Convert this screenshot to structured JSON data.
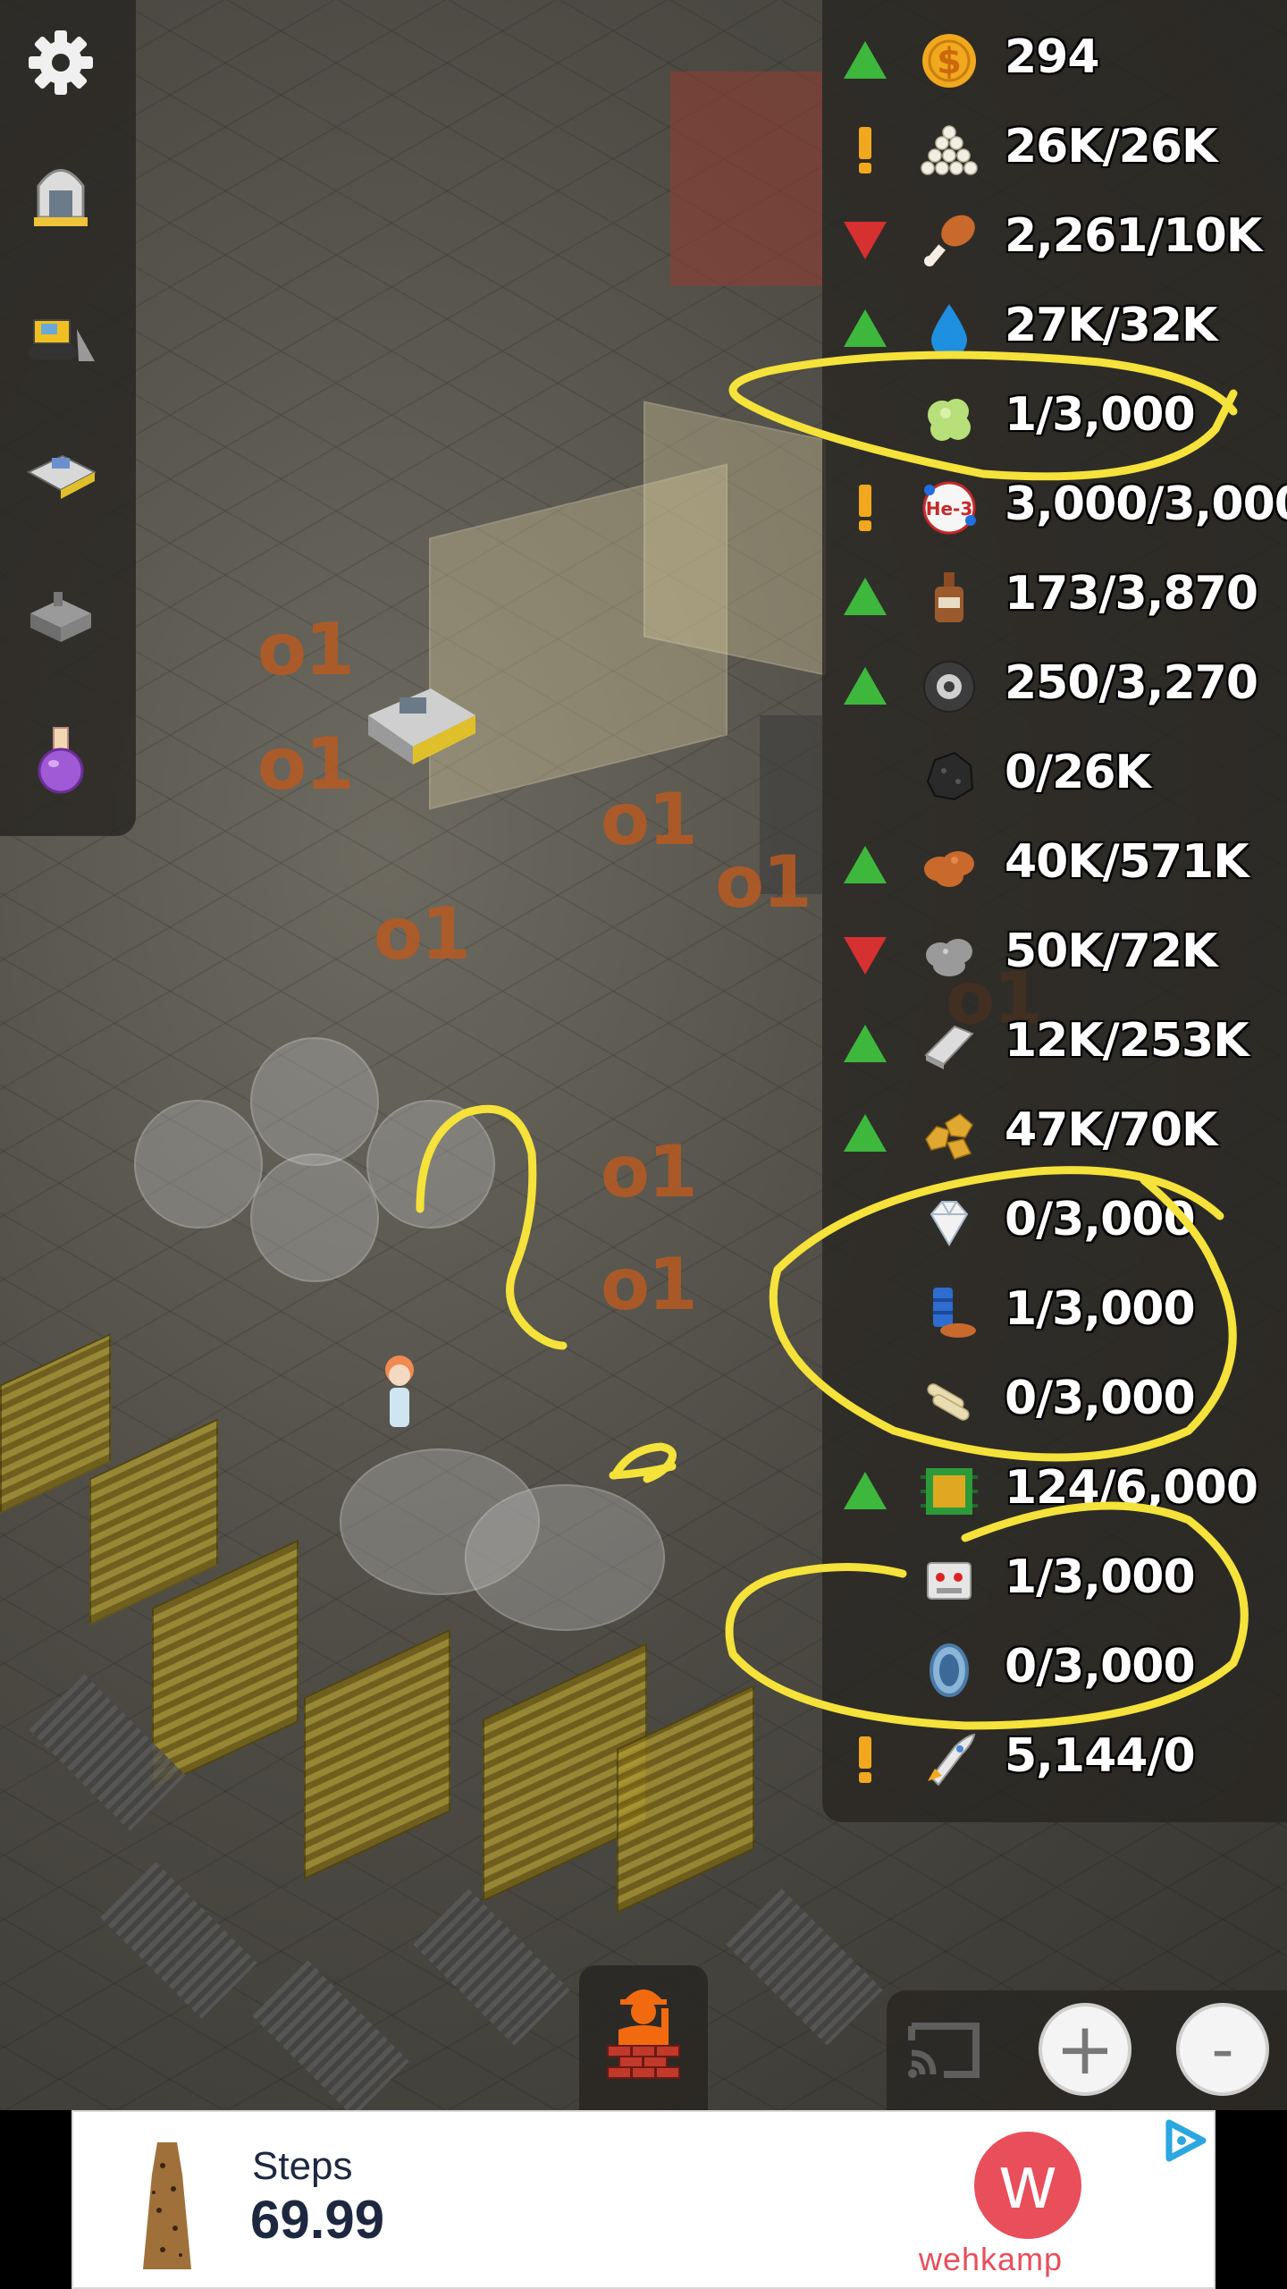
{
  "left_menu": {
    "items": [
      {
        "icon": "gear-icon"
      },
      {
        "icon": "astronaut-habitat-icon"
      },
      {
        "icon": "bulldozer-icon"
      },
      {
        "icon": "rover-icon"
      },
      {
        "icon": "factory-icon"
      },
      {
        "icon": "potion-flask-icon"
      }
    ]
  },
  "resources": [
    {
      "trend": "up",
      "icon": "coin-icon",
      "value": "294"
    },
    {
      "trend": "warning",
      "icon": "crystals-pile-icon",
      "value": "26K/26K"
    },
    {
      "trend": "down",
      "icon": "drumstick-icon",
      "value": "2,261/10K"
    },
    {
      "trend": "up",
      "icon": "water-drop-icon",
      "value": "27K/32K"
    },
    {
      "trend": "none",
      "icon": "green-gas-icon",
      "value": "1/3,000"
    },
    {
      "trend": "warning",
      "icon": "helium-3-icon",
      "icon_text": "He-3",
      "value": "3,000/3,000"
    },
    {
      "trend": "up",
      "icon": "bottle-icon",
      "value": "173/3,870"
    },
    {
      "trend": "up",
      "icon": "disc-icon",
      "value": "250/3,270"
    },
    {
      "trend": "none",
      "icon": "coal-rock-icon",
      "value": "0/26K"
    },
    {
      "trend": "up",
      "icon": "copper-ore-icon",
      "value": "40K/571K"
    },
    {
      "trend": "down",
      "icon": "stone-ore-icon",
      "value": "50K/72K"
    },
    {
      "trend": "up",
      "icon": "metal-bar-icon",
      "value": "12K/253K"
    },
    {
      "trend": "up",
      "icon": "gold-nuggets-icon",
      "value": "47K/70K"
    },
    {
      "trend": "none",
      "icon": "diamond-icon",
      "value": "0/3,000"
    },
    {
      "trend": "none",
      "icon": "fuel-barrel-icon",
      "value": "1/3,000"
    },
    {
      "trend": "none",
      "icon": "bones-icon",
      "value": "0/3,000"
    },
    {
      "trend": "up",
      "icon": "microchip-icon",
      "value": "124/6,000"
    },
    {
      "trend": "none",
      "icon": "robot-icon",
      "value": "1/3,000"
    },
    {
      "trend": "none",
      "icon": "portal-ring-icon",
      "value": "0/3,000"
    },
    {
      "trend": "warning",
      "icon": "rocket-icon",
      "value": "5,144/0"
    }
  ],
  "map_labels": [
    "o1",
    "o1",
    "o1",
    "o1",
    "o1",
    "o1",
    "o1",
    "o1"
  ],
  "bottom_controls": {
    "build_icon": "construction-worker-icon",
    "cast_icon": "cast-icon",
    "zoom_in_label": "+",
    "zoom_out_label": "-"
  },
  "ad": {
    "title": "Steps",
    "price": "69.99",
    "brand": "wehkamp",
    "brand_logo_letter": "w",
    "adchoices_icon": "adchoices-icon"
  },
  "colors": {
    "trend_up": "#3db83d",
    "trend_down": "#d63030",
    "warning": "#f2a81e",
    "annotation": "#f5e23a",
    "ore_label": "#b85a22",
    "ad_brand": "#e94e5b"
  }
}
